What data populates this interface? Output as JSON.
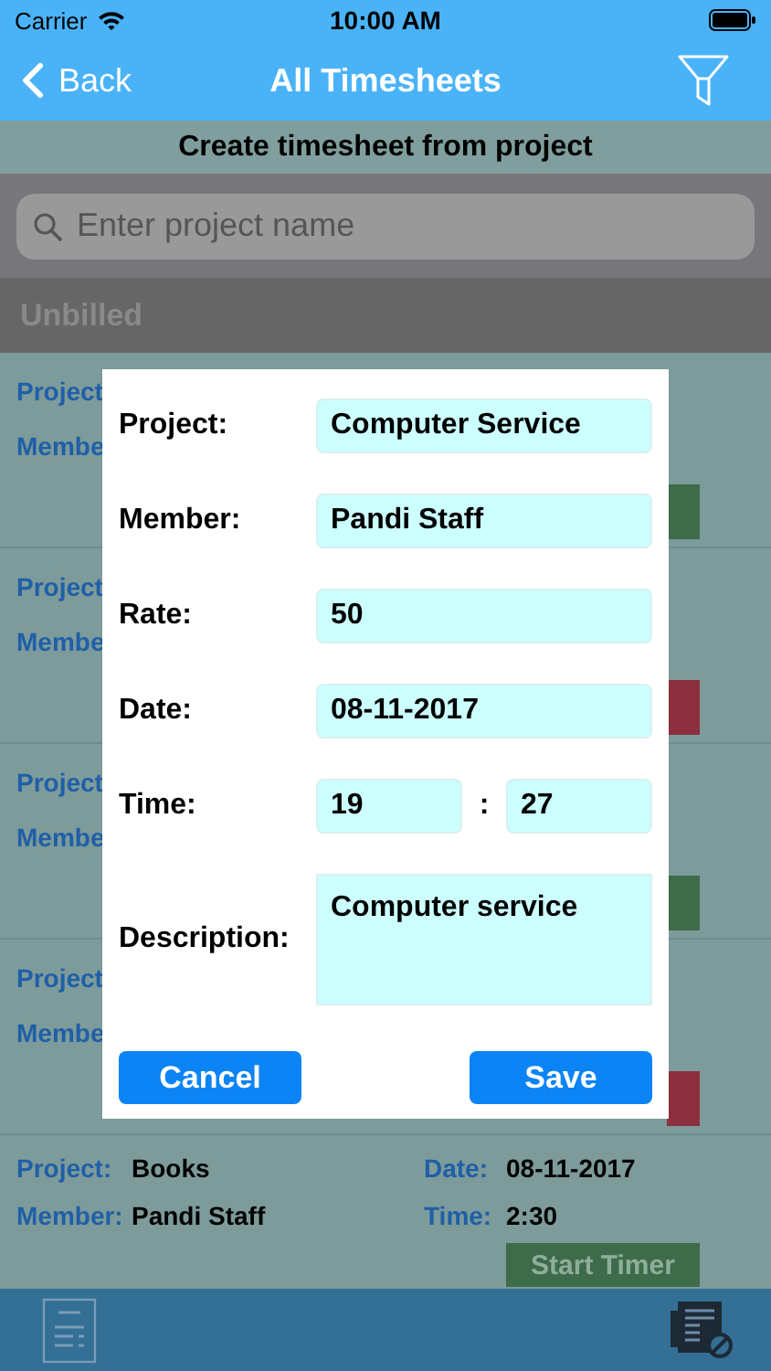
{
  "status_bar": {
    "carrier": "Carrier",
    "time": "10:00 AM"
  },
  "nav": {
    "back": "Back",
    "title": "All Timesheets"
  },
  "header": "Create timesheet from project",
  "search": {
    "placeholder": "Enter project name"
  },
  "section": "Unbilled",
  "rows": [
    {
      "project_label": "Project",
      "member_label": "Membe",
      "timer_running": false
    },
    {
      "project_label": "Project",
      "member_label": "Membe",
      "timer_running": true
    },
    {
      "project_label": "Project",
      "member_label": "Membe",
      "timer_running": false
    },
    {
      "project_label": "Project",
      "member_label": "Membe",
      "timer_running": true
    }
  ],
  "last_row": {
    "project_label": "Project:",
    "project": "Books",
    "date_label": "Date:",
    "date": "08-11-2017",
    "member_label": "Member:",
    "member": "Pandi Staff",
    "time_label": "Time:",
    "time": "2:30",
    "button": "Start Timer",
    "timer_running": false
  },
  "dialog": {
    "fields": [
      {
        "kind": "text",
        "label": "Project:",
        "value": "Computer Service"
      },
      {
        "kind": "text",
        "label": "Member:",
        "value": "Pandi Staff"
      },
      {
        "kind": "text",
        "label": "Rate:",
        "value": "50"
      },
      {
        "kind": "text",
        "label": "Date:",
        "value": "08-11-2017"
      },
      {
        "kind": "time",
        "label": "Time:",
        "hours": "19",
        "separator": ":",
        "minutes": "27"
      },
      {
        "kind": "textarea",
        "label": "Description:",
        "value": "Computer service"
      }
    ],
    "cancel": "Cancel",
    "save": "Save"
  }
}
